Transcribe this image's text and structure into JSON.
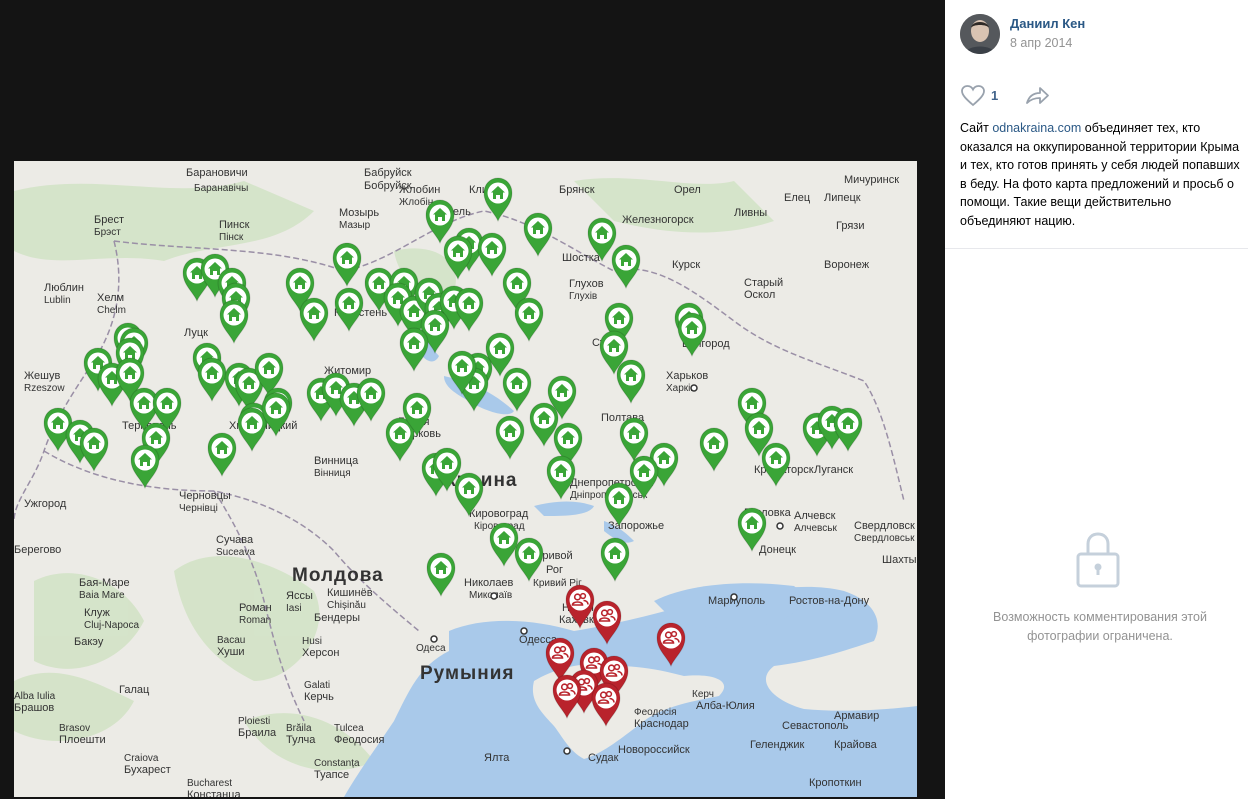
{
  "post": {
    "author": "Даниил Кен",
    "date": "8 апр 2014",
    "likes": "1",
    "text_prefix": "Сайт ",
    "link": "odnakraina.com",
    "text_rest": " объединяет тех, кто оказался на оккупированной территории Крыма и тех, кто готов принять у себя людей попавших в беду. На фото карта предложений и просьб о помощи. Такие вещи действительно объединяют нацию."
  },
  "comments": {
    "restricted": "Возможность комментирования этой фотографии ограничена."
  },
  "icons": {
    "heart": "heart-icon",
    "share": "share-icon",
    "lock": "lock-icon",
    "offer": "house-icon",
    "request": "people-icon"
  },
  "colors": {
    "offer_pin": "#3aa537",
    "request_pin": "#b9232c",
    "sea": "#a9c9ea",
    "land": "#ecebe6"
  },
  "map": {
    "labels": [
      {
        "t": "Бабруйск",
        "c": "city"
      },
      {
        "t": "Бобруйск",
        "c": "city"
      },
      {
        "t": "Барановичи",
        "c": "city"
      },
      {
        "t": "Баранавічы",
        "c": "sub"
      },
      {
        "t": "Клинцы",
        "c": "city"
      },
      {
        "t": "Брянск",
        "c": "city"
      },
      {
        "t": "Орел",
        "c": "city"
      },
      {
        "t": "Мичуринск",
        "c": "city"
      },
      {
        "t": "Жлобин",
        "c": "city"
      },
      {
        "t": "Жлобін",
        "c": "sub"
      },
      {
        "t": "Мозырь",
        "c": "city"
      },
      {
        "t": "Мазыр",
        "c": "sub"
      },
      {
        "t": "Гомель",
        "c": "city"
      },
      {
        "t": "Железногорск",
        "c": "city"
      },
      {
        "t": "Ливны",
        "c": "city"
      },
      {
        "t": "Елец",
        "c": "city"
      },
      {
        "t": "Липецк",
        "c": "city"
      },
      {
        "t": "Грязи",
        "c": "city"
      },
      {
        "t": "Брест",
        "c": "city"
      },
      {
        "t": "Брэст",
        "c": "sub"
      },
      {
        "t": "Пинск",
        "c": "city"
      },
      {
        "t": "Пінск",
        "c": "sub"
      },
      {
        "t": "Курск",
        "c": "city"
      },
      {
        "t": "Воронеж",
        "c": "city"
      },
      {
        "t": "Старый",
        "c": "city"
      },
      {
        "t": "Оскол",
        "c": "city"
      },
      {
        "t": "Шостка",
        "c": "city"
      },
      {
        "t": "Глухов",
        "c": "city"
      },
      {
        "t": "Глухів",
        "c": "sub"
      },
      {
        "t": "Люблин",
        "c": "city"
      },
      {
        "t": "Lublin",
        "c": "sub"
      },
      {
        "t": "Хелм",
        "c": "city"
      },
      {
        "t": "Chelm",
        "c": "sub"
      },
      {
        "t": "Луцк",
        "c": "city"
      },
      {
        "t": "Коростень",
        "c": "city"
      },
      {
        "t": "Сумы",
        "c": "city"
      },
      {
        "t": "Белгород",
        "c": "city"
      },
      {
        "t": "Жешув",
        "c": "city"
      },
      {
        "t": "Rzeszow",
        "c": "sub"
      },
      {
        "t": "Житомир",
        "c": "city"
      },
      {
        "t": "Харьков",
        "c": "city"
      },
      {
        "t": "Харків",
        "c": "sub"
      },
      {
        "t": "Тернополь",
        "c": "city"
      },
      {
        "t": "Хмельницкий",
        "c": "city"
      },
      {
        "t": "Белая",
        "c": "city"
      },
      {
        "t": "Церковь",
        "c": "city"
      },
      {
        "t": "Полтава",
        "c": "city"
      },
      {
        "t": "Винница",
        "c": "city"
      },
      {
        "t": "Вінниця",
        "c": "sub"
      },
      {
        "t": "Украина",
        "c": "country"
      },
      {
        "t": "Днепропетровск",
        "c": "city"
      },
      {
        "t": "Дніпропетровськ",
        "c": "sub"
      },
      {
        "t": "Краматорск",
        "c": "city"
      },
      {
        "t": "Луганск",
        "c": "city"
      },
      {
        "t": "Ужгород",
        "c": "city"
      },
      {
        "t": "Черновцы",
        "c": "city"
      },
      {
        "t": "Чернівці",
        "c": "sub"
      },
      {
        "t": "Кировоград",
        "c": "city"
      },
      {
        "t": "Кіровоград",
        "c": "sub"
      },
      {
        "t": "Запорожье",
        "c": "city"
      },
      {
        "t": "Горловка",
        "c": "city"
      },
      {
        "t": "Алчевск",
        "c": "city"
      },
      {
        "t": "Алчевськ",
        "c": "sub"
      },
      {
        "t": "Донецк",
        "c": "city"
      },
      {
        "t": "Свердловск",
        "c": "city"
      },
      {
        "t": "Свердловськ",
        "c": "sub"
      },
      {
        "t": "Кривой",
        "c": "city"
      },
      {
        "t": "Рог",
        "c": "city"
      },
      {
        "t": "Кривий Ріг",
        "c": "sub"
      },
      {
        "t": "Берегово",
        "c": "city"
      },
      {
        "t": "Сучава",
        "c": "city"
      },
      {
        "t": "Suceava",
        "c": "sub"
      },
      {
        "t": "Молдова",
        "c": "country"
      },
      {
        "t": "Кишинёв",
        "c": "city"
      },
      {
        "t": "Chișinău",
        "c": "sub"
      },
      {
        "t": "Николаев",
        "c": "city"
      },
      {
        "t": "Миколаїв",
        "c": "sub"
      },
      {
        "t": "Шахты",
        "c": "city"
      },
      {
        "t": "Бая-Маре",
        "c": "city"
      },
      {
        "t": "Baia Mare",
        "c": "sub"
      },
      {
        "t": "Роман",
        "c": "city"
      },
      {
        "t": "Roman",
        "c": "sub"
      },
      {
        "t": "Яссы",
        "c": "city"
      },
      {
        "t": "Iasi",
        "c": "sub"
      },
      {
        "t": "Бендеры",
        "c": "city"
      },
      {
        "t": "Новая",
        "c": "city"
      },
      {
        "t": "Каховка",
        "c": "city"
      },
      {
        "t": "Мариуполь",
        "c": "city"
      },
      {
        "t": "Ростов-на-Дону",
        "c": "city"
      },
      {
        "t": "Клуж",
        "c": "city"
      },
      {
        "t": "Cluj-Napoca",
        "c": "sub"
      },
      {
        "t": "Бакэу",
        "c": "city"
      },
      {
        "t": "Bacau",
        "c": "sub"
      },
      {
        "t": "Хуши",
        "c": "city"
      },
      {
        "t": "Husi",
        "c": "sub"
      },
      {
        "t": "Херсон",
        "c": "city"
      },
      {
        "t": "Одесса",
        "c": "city"
      },
      {
        "t": "Одеса",
        "c": "sub"
      },
      {
        "t": "Румыния",
        "c": "country"
      },
      {
        "t": "Галац",
        "c": "city"
      },
      {
        "t": "Galati",
        "c": "sub"
      },
      {
        "t": "Керчь",
        "c": "city"
      },
      {
        "t": "Керч",
        "c": "sub"
      },
      {
        "t": "Алба-Юлия",
        "c": "city"
      },
      {
        "t": "Alba Iulia",
        "c": "sub"
      },
      {
        "t": "Брашов",
        "c": "city"
      },
      {
        "t": "Brasov",
        "c": "sub"
      },
      {
        "t": "Плоешти",
        "c": "city"
      },
      {
        "t": "Ploiesti",
        "c": "sub"
      },
      {
        "t": "Браила",
        "c": "city"
      },
      {
        "t": "Brăila",
        "c": "sub"
      },
      {
        "t": "Тулча",
        "c": "city"
      },
      {
        "t": "Tulcea",
        "c": "sub"
      },
      {
        "t": "Феодосия",
        "c": "city"
      },
      {
        "t": "Феодосія",
        "c": "sub"
      },
      {
        "t": "Краснодар",
        "c": "city"
      },
      {
        "t": "Севастополь",
        "c": "city"
      },
      {
        "t": "Ялта",
        "c": "city"
      },
      {
        "t": "Судак",
        "c": "city"
      },
      {
        "t": "Новороссийск",
        "c": "city"
      },
      {
        "t": "Геленджик",
        "c": "city"
      },
      {
        "t": "Крайова",
        "c": "city"
      },
      {
        "t": "Craiova",
        "c": "sub"
      },
      {
        "t": "Бухарест",
        "c": "city"
      },
      {
        "t": "Bucharest",
        "c": "sub"
      },
      {
        "t": "Констанца",
        "c": "city"
      },
      {
        "t": "Constanța",
        "c": "sub"
      },
      {
        "t": "Туапсе",
        "c": "city"
      },
      {
        "t": "Кропоткин",
        "c": "city"
      },
      {
        "t": "Армавир",
        "c": "city"
      }
    ]
  }
}
